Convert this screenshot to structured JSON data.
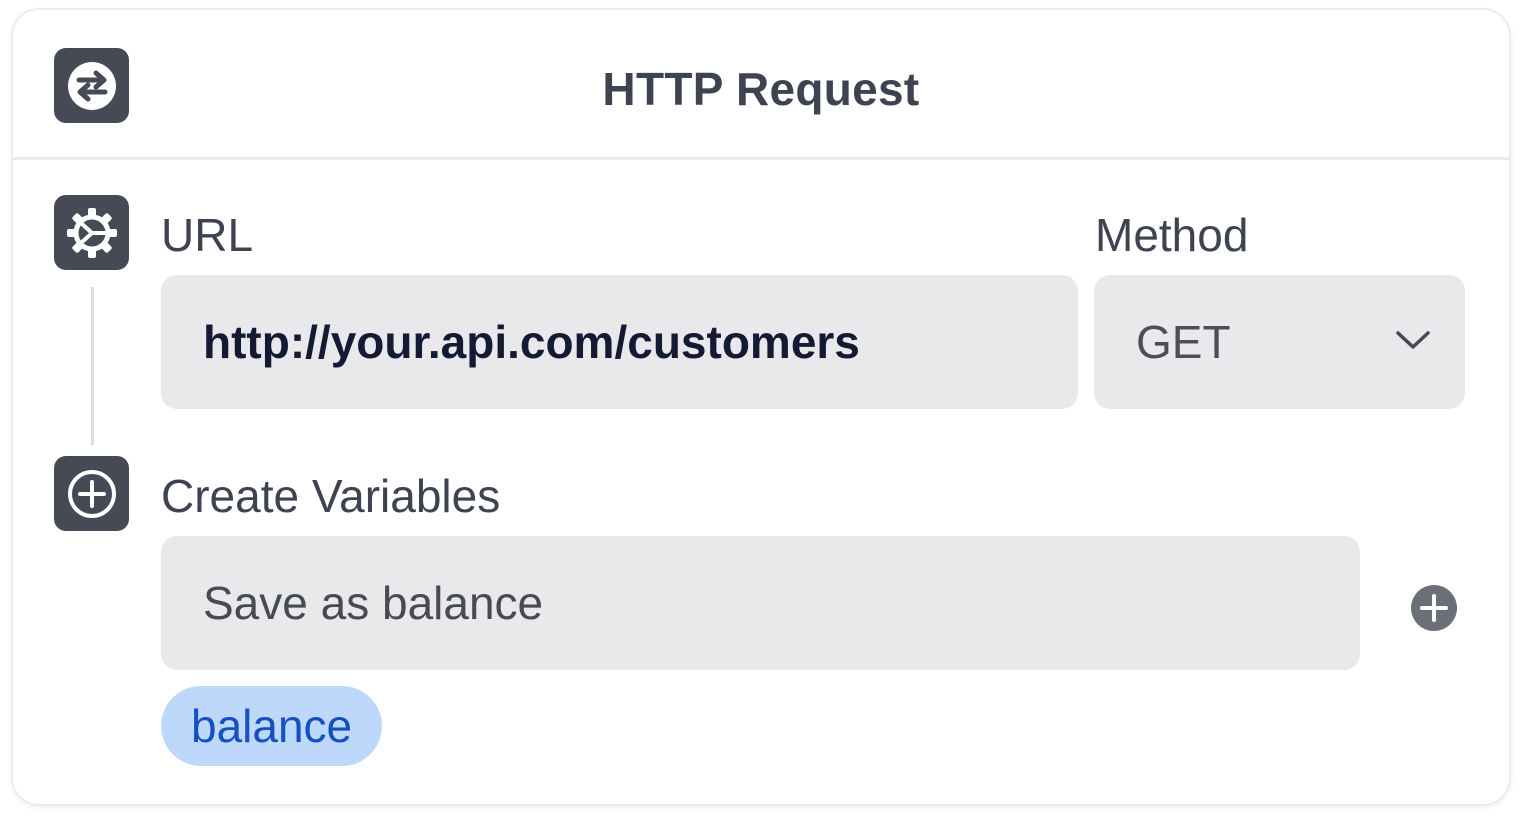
{
  "header": {
    "title": "HTTP Request",
    "icon": "swap-arrows-icon"
  },
  "url_section": {
    "icon": "gear-icon",
    "url_label": "URL",
    "url_value": "http://your.api.com/customers",
    "method_label": "Method",
    "method_value": "GET"
  },
  "variables_section": {
    "icon": "plus-icon",
    "label": "Create Variables",
    "input_value": "Save as balance",
    "tag": "balance"
  },
  "colors": {
    "icon_bg": "#454a55",
    "field_bg": "#e9e9ec",
    "tag_bg": "#bed8fb",
    "tag_text": "#1450bf"
  }
}
